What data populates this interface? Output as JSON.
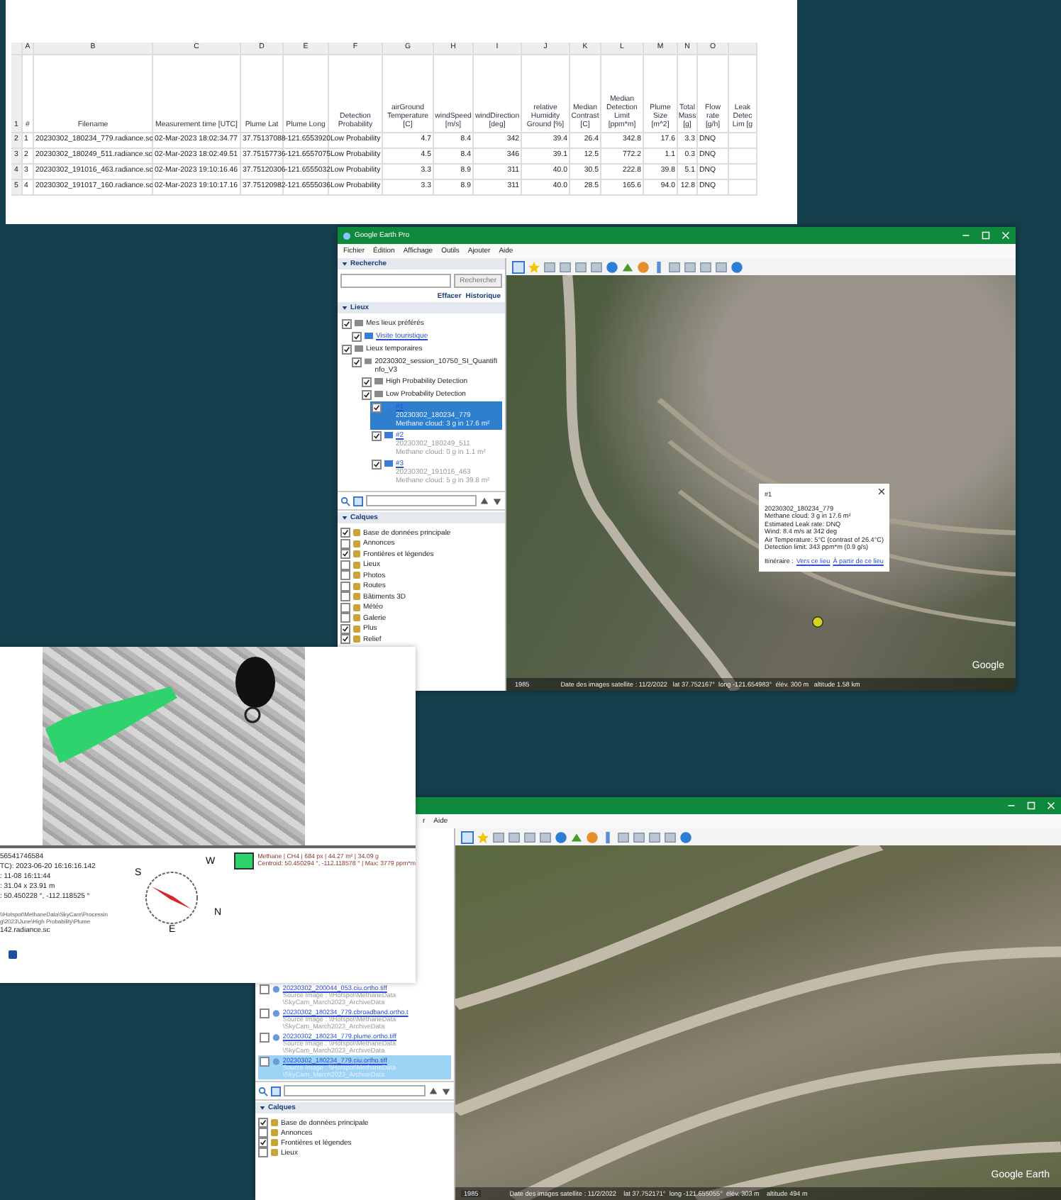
{
  "spreadsheet": {
    "column_letters": [
      "A",
      "B",
      "C",
      "D",
      "E",
      "F",
      "G",
      "H",
      "I",
      "J",
      "K",
      "L",
      "M",
      "N",
      "O"
    ],
    "header_row_number": "1",
    "headers": [
      "#",
      "Filename",
      "Measurement time [UTC]",
      "Plume Lat",
      "Plume Long",
      "Detection Probability",
      "airGround Temperature [C]",
      "windSpeed [m/s]",
      "windDirection [deg]",
      "relative Humidity Ground [%]",
      "Median Contrast [C]",
      "Median Detection Limit [ppm*m]",
      "Plume Size [m^2]",
      "Total Mass [g]",
      "Flow rate [g/h]",
      "Leak Detec Lim [g"
    ],
    "rows": [
      {
        "number": "2",
        "cells": [
          "1",
          "20230302_180234_779.radiance.sc",
          "02-Mar-2023 18:02:34.77",
          "37.75137088",
          "-121.6553920",
          "Low Probability",
          "4.7",
          "8.4",
          "342",
          "39.4",
          "26.4",
          "342.8",
          "17.6",
          "3.3",
          "DNQ"
        ]
      },
      {
        "number": "3",
        "cells": [
          "2",
          "20230302_180249_511.radiance.sc",
          "02-Mar-2023 18:02:49.51",
          "37.75157736",
          "-121.6557075",
          "Low Probability",
          "4.5",
          "8.4",
          "346",
          "39.1",
          "12.5",
          "772.2",
          "1.1",
          "0.3",
          "DNQ"
        ]
      },
      {
        "number": "4",
        "cells": [
          "3",
          "20230302_191016_463.radiance.sc",
          "02-Mar-2023 19:10:16.46",
          "37.75120306",
          "-121.6555032",
          "Low Probability",
          "3.3",
          "8.9",
          "311",
          "40.0",
          "30.5",
          "222.8",
          "39.8",
          "5.1",
          "DNQ"
        ]
      },
      {
        "number": "5",
        "cells": [
          "4",
          "20230302_191017_160.radiance.sc",
          "02-Mar-2023 19:10:17.16",
          "37.75120982",
          "-121.6555036",
          "Low Probability",
          "3.3",
          "8.9",
          "311",
          "40.0",
          "28.5",
          "165.6",
          "94.0",
          "12.8",
          "DNQ"
        ]
      }
    ]
  },
  "earth_top": {
    "title": "Google Earth Pro",
    "menu": [
      "Fichier",
      "Édition",
      "Affichage",
      "Outils",
      "Ajouter",
      "Aide"
    ],
    "search_header": "Recherche",
    "search_button": "Rechercher",
    "search_links": [
      "Effacer",
      "Historique"
    ],
    "places_header": "Lieux",
    "places": [
      {
        "label": "Mes lieux préférés",
        "checked": true,
        "selected": false,
        "link": false,
        "children": [
          {
            "label": "Visite touristique",
            "checked": true,
            "selected": false,
            "link": true
          }
        ]
      },
      {
        "label": "Lieux temporaires",
        "checked": true,
        "selected": false,
        "link": false,
        "children": [
          {
            "label": "20230302_session_10750_SI_QuantifInfo_V3",
            "checked": true,
            "selected": false,
            "link": false,
            "children": [
              {
                "label": "High Probability Detection",
                "checked": true,
                "selected": false,
                "link": false
              },
              {
                "label": "Low Probability Detection",
                "checked": true,
                "selected": false,
                "link": false,
                "children": [
                  {
                    "label": "#1",
                    "checked": true,
                    "selected": true,
                    "link": true,
                    "description": [
                      "20230302_180234_779",
                      "Methane cloud: 3 g in 17.6 m²"
                    ]
                  },
                  {
                    "label": "#2",
                    "checked": true,
                    "selected": false,
                    "link": true,
                    "description": [
                      "20230302_180249_511",
                      "Methane cloud: 0 g in 1.1 m²"
                    ]
                  },
                  {
                    "label": "#3",
                    "checked": true,
                    "selected": false,
                    "link": true,
                    "description": [
                      "20230302_191016_463",
                      "Methane cloud: 5 g in 39.8 m²"
                    ]
                  }
                ]
              }
            ]
          }
        ]
      }
    ],
    "layers_header": "Calques",
    "layers": [
      {
        "label": "Base de données principale",
        "checked": true
      },
      {
        "label": "Annonces",
        "checked": false
      },
      {
        "label": "Frontières et légendes",
        "checked": true
      },
      {
        "label": "Lieux",
        "checked": false
      },
      {
        "label": "Photos",
        "checked": false
      },
      {
        "label": "Routes",
        "checked": false
      },
      {
        "label": "Bâtiments 3D",
        "checked": false
      },
      {
        "label": "Météo",
        "checked": false
      },
      {
        "label": "Galerie",
        "checked": false
      },
      {
        "label": "Plus",
        "checked": true
      },
      {
        "label": "Relief",
        "checked": true
      }
    ],
    "popup": {
      "title": "#1",
      "lines": [
        "20230302_180234_779",
        "Methane cloud: 3 g in 17.6 m²",
        "Estimated Leak rate: DNQ",
        "Wind: 8.4 m/s at 342 deg",
        "Air Temperature: 5°C (contrast of 26.4°C)",
        "Detection limit: 343 ppm*m (0.9 g/s)"
      ],
      "directions_label": "Itinéraire :",
      "links": [
        "Vers ce lieu",
        "À partir de ce lieu"
      ]
    },
    "year_badge": "1985",
    "map_logo": "Google",
    "status": "Date des images satellite : 11/2/2022   lat 37.752167°  long -121.654983°  élév. 300 m   altitude 1.58 km"
  },
  "image_panel": {
    "info_lines": [
      "56541746584",
      "TC): 2023-06-20 16:16:16.142",
      ": 11-08 16:11:44",
      ": 31.04 x 23.91 m",
      ": 50.450228 °, -112.118525 °"
    ],
    "path_line": "\\\\Hotspot\\MethaneData\\SkyCam\\Processing\\2023\\June\\High Probability\\Plume",
    "file_line": "142.radiance.sc",
    "compass_labels": [
      "W",
      "S",
      "N",
      "E"
    ],
    "legend_title": "Methane | CH4 | 684 px | 44.27 m² | 34.09 g",
    "legend_detail": "Centroid: 50.450294 °, -112.118578 ° | Max: 3779 ppm*m"
  },
  "earth_bottom": {
    "menu": [
      "r",
      "Aide"
    ],
    "files": [
      {
        "label": "20230302_200044_053.ciu.ortho.tiff",
        "checked": false,
        "selected": false,
        "description": "Source Image : \\\\Hotspot\\MethaneData \\SkyCam_March2023_ArchiveData"
      },
      {
        "label": "20230302_180234_779.cbroadband.ortho.t",
        "checked": false,
        "selected": false,
        "description": "Source Image : \\\\Hotspot\\MethaneData \\SkyCam_March2023_ArchiveData"
      },
      {
        "label": "20230302_180234_779.plume.ortho.tiff",
        "checked": false,
        "selected": false,
        "description": "Source Image : \\\\Hotspot\\MethaneData \\SkyCam_March2023_ArchiveData"
      },
      {
        "label": "20230302_180234_779.ciu.ortho.tiff",
        "checked": false,
        "selected": true,
        "description": "Source Image : \\\\Hotspot\\MethaneData \\SkyCam_March2023_ArchiveData"
      }
    ],
    "layers_header": "Calques",
    "layers": [
      {
        "label": "Base de données principale",
        "checked": true
      },
      {
        "label": "Annonces",
        "checked": false
      },
      {
        "label": "Frontières et légendes",
        "checked": true
      },
      {
        "label": "Lieux",
        "checked": false
      }
    ],
    "year_badge": "1985",
    "map_logo": "Google Earth",
    "status": "Date des images satellite : 11/2/2022    lat 37.752171°  long -121.655055°  élév. 303 m    altitude 494 m"
  }
}
